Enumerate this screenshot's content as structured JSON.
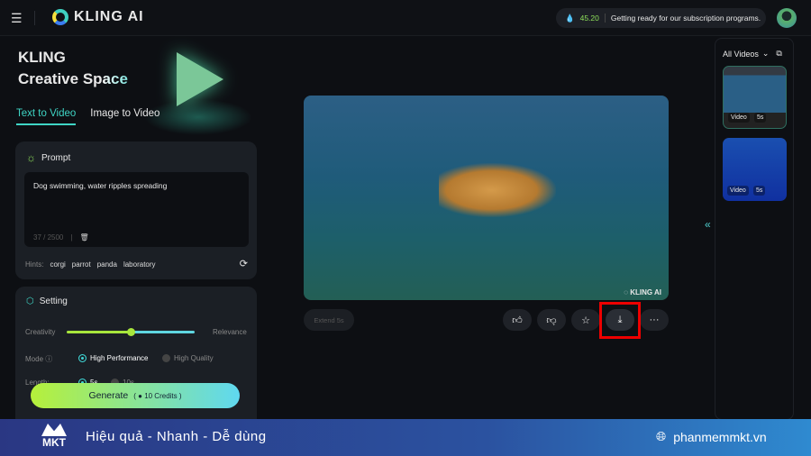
{
  "header": {
    "brand": "KLING AI",
    "credits": "45.20",
    "announcement": "Getting ready for our subscription programs."
  },
  "hero": {
    "line1": "KLING",
    "line2a": "Creative Sp",
    "line2b": "ace"
  },
  "tabs": [
    {
      "label": "Text to Video",
      "active": true
    },
    {
      "label": "Image to Video",
      "active": false
    }
  ],
  "prompt": {
    "title": "Prompt",
    "value": "Dog swimming, water ripples spreading",
    "count": "37 / 2500",
    "hints_label": "Hints:",
    "hints": [
      "corgi",
      "parrot",
      "panda",
      "laboratory"
    ]
  },
  "setting": {
    "title": "Setting",
    "slider_left": "Creativity",
    "slider_right": "Relevance",
    "slider_value": 0.5,
    "mode_label": "Mode",
    "modes": [
      "High Performance",
      "High Quality"
    ],
    "mode_selected": "High Performance",
    "length_label": "Length:",
    "lengths": [
      "5s",
      "10s"
    ],
    "length_selected": "5s"
  },
  "generate": {
    "label": "Generate",
    "credits": "10 Credits"
  },
  "video": {
    "watermark": "KLING AI",
    "extend_label": "Extend 5s"
  },
  "actions": {
    "like": "like",
    "dislike": "dislike",
    "favorite": "favorite",
    "download": "download",
    "more": "···"
  },
  "sidebar": {
    "filter": "All Videos",
    "items": [
      {
        "type": "Video",
        "duration": "5s"
      },
      {
        "type": "Video",
        "duration": "5s"
      }
    ]
  },
  "banner": {
    "logo": "MKT",
    "slogan": "Hiệu quả - Nhanh - Dễ dùng",
    "site": "phanmemmkt.vn"
  },
  "colors": {
    "accent": "#3fd5c5",
    "highlight": "#e00000",
    "banner": "#2a3783"
  }
}
